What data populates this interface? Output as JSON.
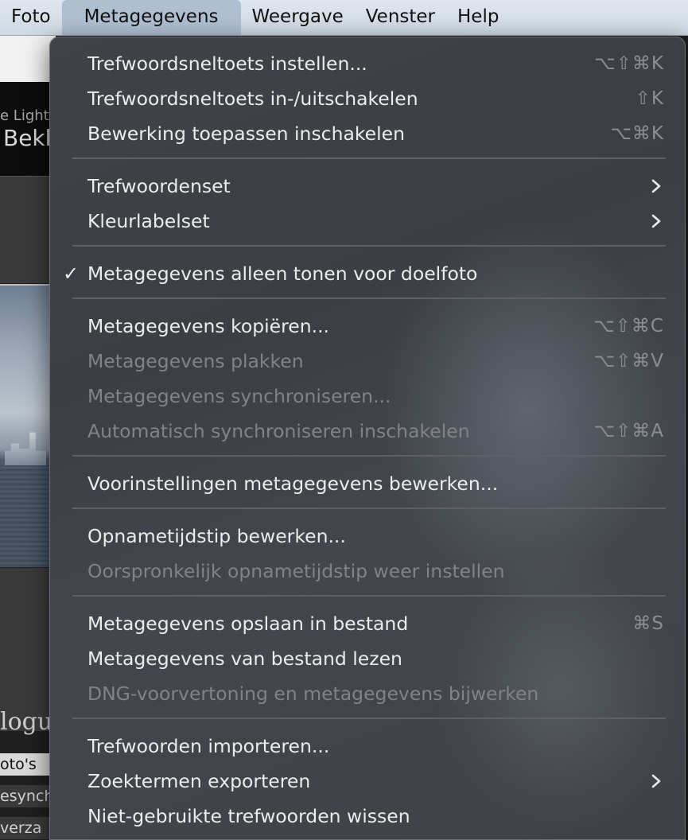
{
  "menubar": {
    "items": [
      {
        "label": "Foto"
      },
      {
        "label": "Metagegevens"
      },
      {
        "label": "Weergave"
      },
      {
        "label": "Venster"
      },
      {
        "label": "Help"
      }
    ]
  },
  "background": {
    "brand_line": "e Lightr",
    "title_fragment": "Bekl",
    "catalog_fragment": "logus",
    "row1": "oto's",
    "row2": "esynch",
    "row3": "verza"
  },
  "menu": {
    "items": [
      {
        "label": "Trefwoordsneltoets instellen...",
        "shortcut": "⌥⇧⌘K",
        "enabled": true
      },
      {
        "label": "Trefwoordsneltoets in-/uitschakelen",
        "shortcut": "⇧K",
        "enabled": true
      },
      {
        "label": "Bewerking toepassen inschakelen",
        "shortcut": "⌥⌘K",
        "enabled": true
      },
      {
        "label": "Trefwoordenset",
        "submenu": true,
        "enabled": true
      },
      {
        "label": "Kleurlabelset",
        "submenu": true,
        "enabled": true
      },
      {
        "label": "Metagegevens alleen tonen voor doelfoto",
        "checked": true,
        "checkmark": "✓",
        "enabled": true
      },
      {
        "label": "Metagegevens kopiëren...",
        "shortcut": "⌥⇧⌘C",
        "enabled": true
      },
      {
        "label": "Metagegevens plakken",
        "shortcut": "⌥⇧⌘V",
        "enabled": false
      },
      {
        "label": "Metagegevens synchroniseren...",
        "enabled": false
      },
      {
        "label": "Automatisch synchroniseren inschakelen",
        "shortcut": "⌥⇧⌘A",
        "enabled": false
      },
      {
        "label": "Voorinstellingen metagegevens bewerken...",
        "enabled": true
      },
      {
        "label": "Opnametijdstip bewerken...",
        "enabled": true
      },
      {
        "label": "Oorspronkelijk opnametijdstip weer instellen",
        "enabled": false
      },
      {
        "label": "Metagegevens opslaan in bestand",
        "shortcut": "⌘S",
        "enabled": true
      },
      {
        "label": "Metagegevens van bestand lezen",
        "enabled": true
      },
      {
        "label": "DNG-voorvertoning en metagegevens bijwerken",
        "enabled": false
      },
      {
        "label": "Trefwoorden importeren...",
        "enabled": true
      },
      {
        "label": "Zoektermen exporteren",
        "submenu": true,
        "enabled": true
      },
      {
        "label": "Niet-gebruikte trefwoorden wissen",
        "enabled": true
      }
    ]
  }
}
